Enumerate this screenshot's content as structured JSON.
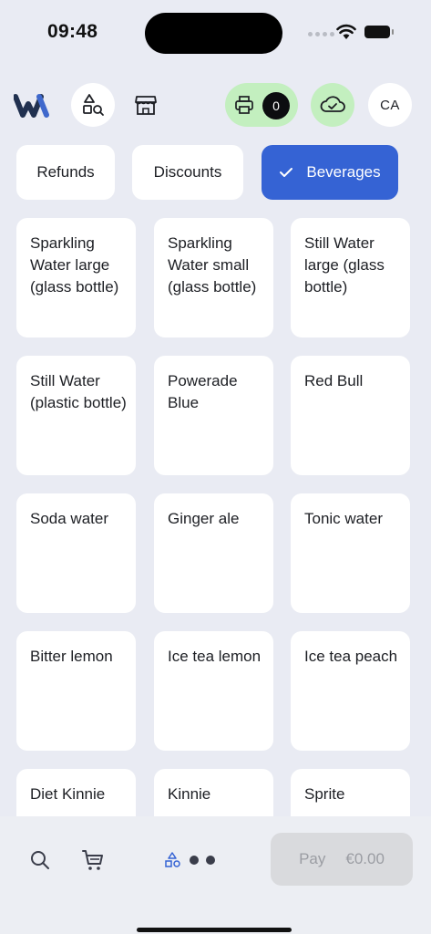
{
  "status": {
    "time": "09:48"
  },
  "header": {
    "printer_count": "0",
    "avatar_initials": "CA"
  },
  "tabs": [
    {
      "label": "Refunds",
      "active": false
    },
    {
      "label": "Discounts",
      "active": false
    },
    {
      "label": "Beverages",
      "active": true
    }
  ],
  "products": [
    "Sparkling Water large (glass bottle)",
    "Sparkling Water small (glass bottle)",
    "Still Water large (glass bottle)",
    "Still Water (plastic bottle)",
    "Powerade Blue",
    "Red Bull",
    "Soda water",
    "Ginger ale",
    "Tonic water",
    "Bitter lemon",
    "Ice tea lemon",
    "Ice tea peach",
    "Diet Kinnie",
    "Kinnie",
    "Sprite"
  ],
  "bottom": {
    "pay_label": "Pay",
    "pay_amount": "€0.00"
  },
  "colors": {
    "accent": "#3563d4",
    "online_green": "#c3efbf",
    "background": "#e9ebf3"
  },
  "icons": {
    "logo": "brand-w-logo",
    "catalog": "shapes-search-icon",
    "store": "store-icon",
    "printer": "printer-icon",
    "cloud": "cloud-check-icon",
    "search": "search-icon",
    "cart": "cart-icon",
    "shapes": "shapes-icon"
  }
}
